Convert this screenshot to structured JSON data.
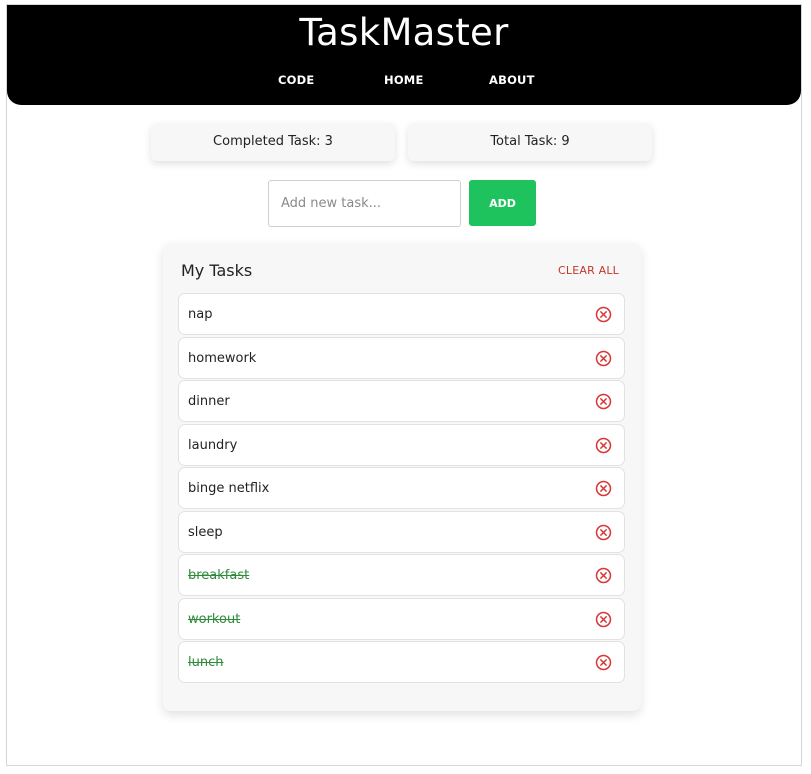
{
  "app": {
    "title": "TaskMaster",
    "nav": [
      "CODE",
      "HOME",
      "ABOUT"
    ]
  },
  "stats": {
    "completed_label": "Completed Task: 3",
    "total_label": "Total Task: 9"
  },
  "new_task": {
    "placeholder": "Add new task...",
    "value": "",
    "add_label": "ADD"
  },
  "tasks_panel": {
    "title": "My Tasks",
    "clear_label": "CLEAR ALL",
    "items": [
      {
        "text": "nap",
        "completed": false
      },
      {
        "text": "homework",
        "completed": false
      },
      {
        "text": "dinner",
        "completed": false
      },
      {
        "text": "laundry",
        "completed": false
      },
      {
        "text": "binge netflix",
        "completed": false
      },
      {
        "text": "sleep",
        "completed": false
      },
      {
        "text": "breakfast",
        "completed": true
      },
      {
        "text": "workout",
        "completed": true
      },
      {
        "text": "lunch",
        "completed": true
      }
    ],
    "delete_icon": "close-circle-icon"
  },
  "colors": {
    "header_bg": "#000000",
    "accent_green": "#1fc35e",
    "completed_text": "#2e8b3a",
    "danger_red": "#d93636"
  }
}
